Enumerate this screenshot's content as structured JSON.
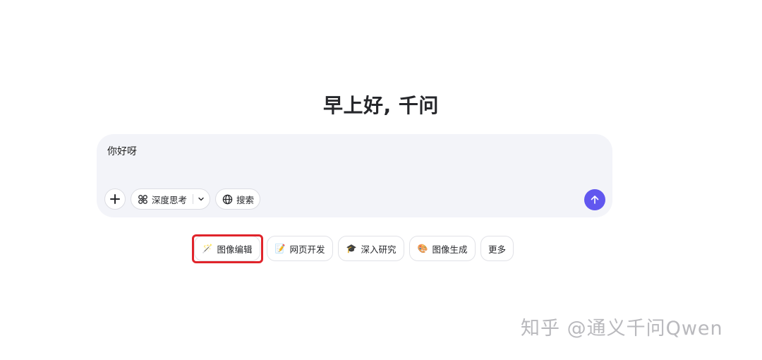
{
  "greeting": "早上好, 千问",
  "chat": {
    "input_value": "你好呀",
    "buttons": {
      "deep_think_label": "深度思考",
      "search_label": "搜索"
    },
    "accent_color": "#6157ef"
  },
  "quick_actions": [
    {
      "label": "图像编辑",
      "icon": "image-edit-icon",
      "emoji": "🪄",
      "highlighted": true
    },
    {
      "label": "网页开发",
      "icon": "web-dev-icon",
      "emoji": "📝"
    },
    {
      "label": "深入研究",
      "icon": "graduation-cap-icon",
      "emoji": "🎓"
    },
    {
      "label": "图像生成",
      "icon": "palette-icon",
      "emoji": "🎨"
    },
    {
      "label": "更多",
      "icon": ""
    }
  ],
  "highlight_color": "#e0242b",
  "watermark": "知乎 @通义千问Qwen"
}
